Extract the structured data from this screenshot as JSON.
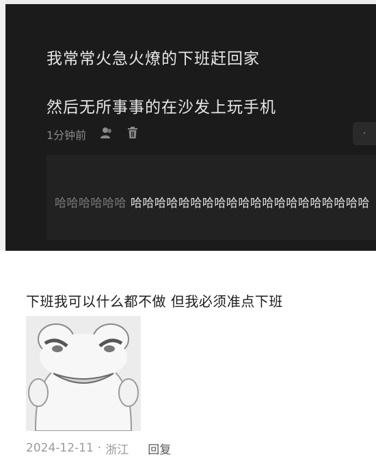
{
  "post": {
    "line1": "我常常火急火燎的下班赶回家",
    "line2": "然后无所事事的在沙发上玩手机",
    "time": "1分钟前",
    "icons": [
      "user-icon",
      "trash-icon"
    ],
    "more": "·"
  },
  "reply": {
    "faded": "哈哈哈哈哈哈",
    "text": "哈哈哈哈哈哈哈哈哈哈哈哈哈哈哈哈哈哈哈哈"
  },
  "comment": {
    "text": "下班我可以什么都不做 但我必须准点下班",
    "sticker": "frog-meme-sticker",
    "date": "2024-12-11",
    "separator": "·",
    "location": "浙江",
    "reply_label": "回复"
  }
}
